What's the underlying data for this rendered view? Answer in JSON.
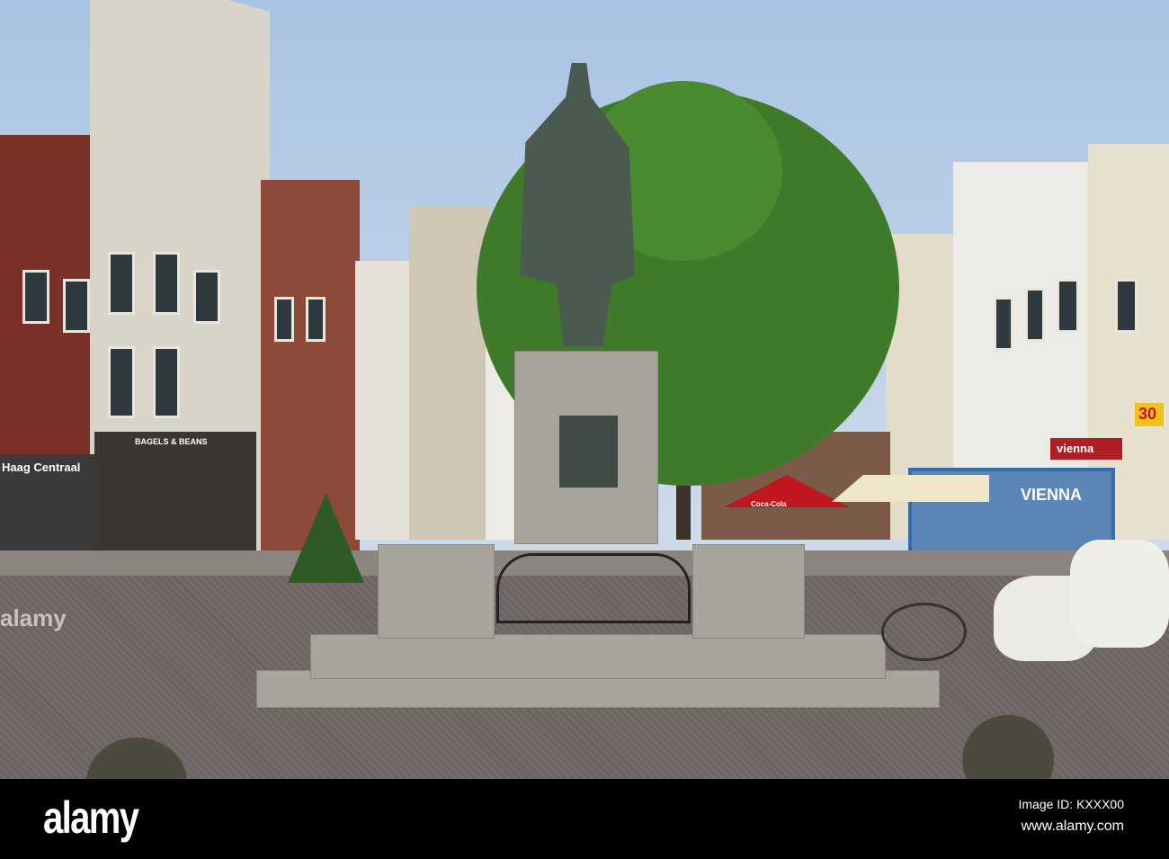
{
  "scene": {
    "signs": {
      "haag": "Haag Centraal",
      "bagels": "BAGELS & BEANS",
      "vienna_sign": "vienna",
      "vienna_window": "VIENNA",
      "cocacola": "Coca-Cola",
      "number": "30"
    }
  },
  "watermark": {
    "logo": "alamy",
    "image_id": "Image ID: KXXX00",
    "url": "www.alamy.com",
    "center": "alamy"
  },
  "colors": {
    "sky": "#a9c3e4",
    "tree": "#3f7a2a",
    "statue": "#4a5a50",
    "umbrella": "#c0161d"
  }
}
